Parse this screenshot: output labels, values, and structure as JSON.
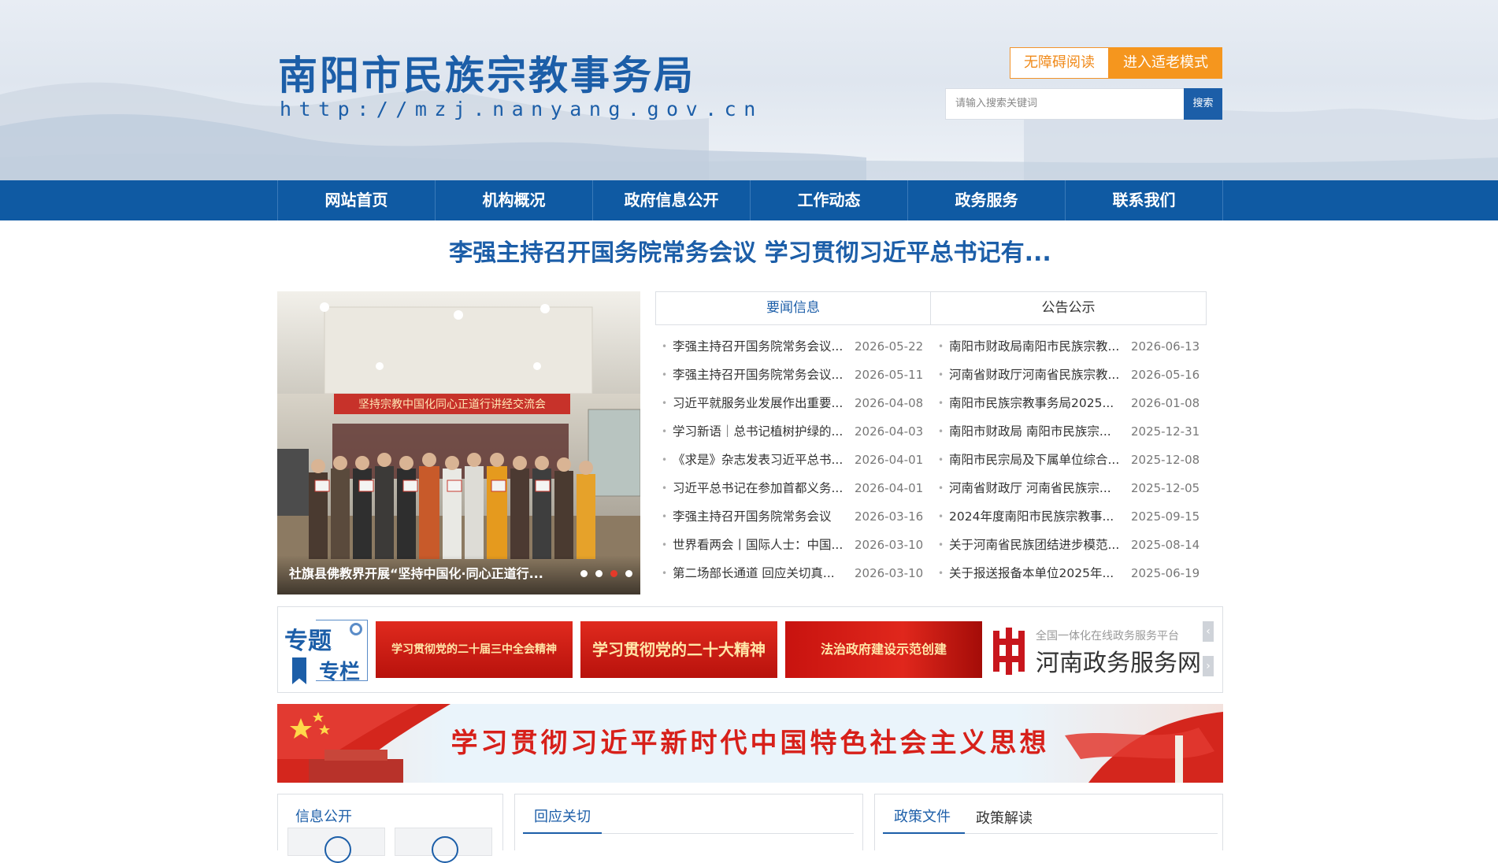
{
  "header": {
    "title": "南阳市民族宗教事务局",
    "url": "http://mzj.nanyang.gov.cn",
    "accessibility_button": "无障碍阅读",
    "elder_mode_button": "进入适老模式",
    "search_placeholder": "请输入搜索关键词",
    "search_button": "搜索"
  },
  "nav": [
    "网站首页",
    "机构概况",
    "政府信息公开",
    "工作动态",
    "政务服务",
    "联系我们"
  ],
  "headline": "李强主持召开国务院常务会议 学习贯彻习近平总书记有...",
  "carousel": {
    "banner_text": "坚持宗教中国化同心正道行讲经交流会",
    "caption": "社旗县佛教界开展“坚持中国化·同心正道行...",
    "active_dot": 3,
    "dot_count": 4
  },
  "tabs": [
    "要闻信息",
    "公告公示"
  ],
  "news_left": [
    {
      "title": "李强主持召开国务院常务会议...",
      "date": "2026-05-22"
    },
    {
      "title": "李强主持召开国务院常务会议...",
      "date": "2026-05-11"
    },
    {
      "title": "习近平就服务业发展作出重要...",
      "date": "2026-04-08"
    },
    {
      "title": "学习新语｜总书记植树护绿的...",
      "date": "2026-04-03"
    },
    {
      "title": "《求是》杂志发表习近平总书...",
      "date": "2026-04-01"
    },
    {
      "title": "习近平总书记在参加首都义务...",
      "date": "2026-04-01"
    },
    {
      "title": "李强主持召开国务院常务会议",
      "date": "2026-03-16"
    },
    {
      "title": "世界看两会丨国际人士：中国...",
      "date": "2026-03-10"
    },
    {
      "title": "第二场部长通道 回应关切真...",
      "date": "2026-03-10"
    }
  ],
  "news_right": [
    {
      "title": "南阳市财政局南阳市民族宗教...",
      "date": "2026-06-13"
    },
    {
      "title": "河南省财政厅河南省民族宗教...",
      "date": "2026-05-16"
    },
    {
      "title": "南阳市民族宗教事务局2025...",
      "date": "2026-01-08"
    },
    {
      "title": "南阳市财政局 南阳市民族宗...",
      "date": "2025-12-31"
    },
    {
      "title": "南阳市民宗局及下属单位综合...",
      "date": "2025-12-08"
    },
    {
      "title": "河南省财政厅 河南省民族宗...",
      "date": "2025-12-05"
    },
    {
      "title": "2024年度南阳市民族宗教事...",
      "date": "2025-09-15"
    },
    {
      "title": "关于河南省民族团结进步模范...",
      "date": "2025-08-14"
    },
    {
      "title": "关于报送报备本单位2025年...",
      "date": "2025-06-19"
    }
  ],
  "topics": {
    "label_1": "专题",
    "label_2": "专栏",
    "banners": [
      "学习贯彻党的二十届三中全会精神",
      "学习贯彻党的二十大精神",
      "法治政府建设示范创建"
    ],
    "henan_small": "全国一体化在线政务服务平台",
    "henan_big": "河南政务服务网",
    "arrow_up": "‹",
    "arrow_down": "›"
  },
  "thought_banner": "学习贯彻习近平新时代中国特色社会主义思想",
  "bottom": {
    "info_title": "信息公开",
    "response_title": "回应关切",
    "policy_tab_1": "政策文件",
    "policy_tab_2": "政策解读"
  },
  "colors": {
    "brand_blue": "#1c5ea8",
    "nav_blue": "#0f5aa3",
    "orange": "#f5961e",
    "red": "#d7201a"
  }
}
